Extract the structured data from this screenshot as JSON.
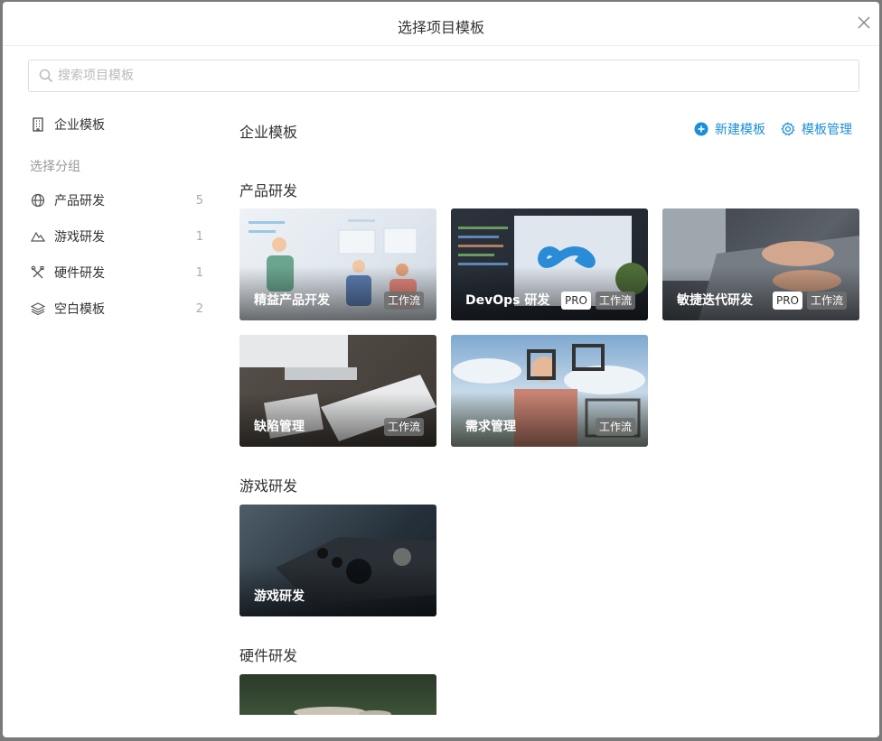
{
  "dialog": {
    "title": "选择项目模板"
  },
  "search": {
    "placeholder": "搜索项目模板"
  },
  "sidebar": {
    "enterprise_label": "企业模板",
    "group_label": "选择分组",
    "items": [
      {
        "label": "产品研发",
        "count": "5",
        "icon": "globe-icon"
      },
      {
        "label": "游戏研发",
        "count": "1",
        "icon": "mountain-icon"
      },
      {
        "label": "硬件研发",
        "count": "1",
        "icon": "tools-icon"
      },
      {
        "label": "空白模板",
        "count": "2",
        "icon": "layers-icon"
      }
    ]
  },
  "main": {
    "title": "企业模板",
    "new_template_label": "新建模板",
    "manage_label": "模板管理"
  },
  "sections": [
    {
      "title": "产品研发",
      "cards": [
        {
          "name": "精益产品开发",
          "pro": "",
          "flow": "工作流"
        },
        {
          "name": "DevOps 研发",
          "pro": "PRO",
          "flow": "工作流"
        },
        {
          "name": "敏捷迭代研发",
          "pro": "PRO",
          "flow": "工作流"
        },
        {
          "name": "缺陷管理",
          "pro": "",
          "flow": "工作流"
        },
        {
          "name": "需求管理",
          "pro": "",
          "flow": "工作流"
        }
      ]
    },
    {
      "title": "游戏研发",
      "cards": [
        {
          "name": "游戏研发"
        }
      ]
    },
    {
      "title": "硬件研发",
      "cards": [
        {
          "name": ""
        }
      ]
    }
  ],
  "colors": {
    "accent": "#1a8fd8",
    "backdrop": "#7a7a7a"
  }
}
